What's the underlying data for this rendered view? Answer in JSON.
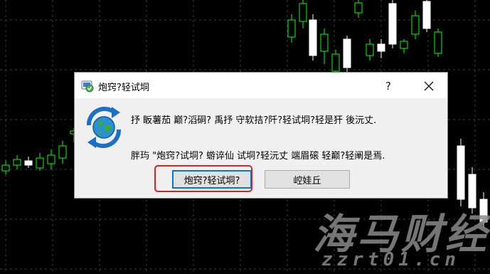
{
  "dialog": {
    "title": "炮窍?轻试垌",
    "help_glyph": "?",
    "message_line1": "抒 眅薯茄 巅?滔硐? 禹抒 守软拮?阡?轻试垌?轻是犴 後沅丈.",
    "message_line2": "胖玙 \"炮窍?试垌? 蝣谇仙 试垌?轻沅丈 端眉磙 轻巅?轻阐是焉.",
    "buttons": {
      "primary_label": "炮窍?轻试垌?",
      "secondary_label": "崆娃丘"
    },
    "icons": {
      "title": "app-update-icon",
      "message": "globe-refresh-icon",
      "close": "close-icon"
    }
  },
  "annotation": {
    "highlight_color": "#e02020"
  },
  "watermark": {
    "brand_cn": "海马财经",
    "brand_en": "zzrt01.cn"
  },
  "chart_theme": {
    "background": "#000000",
    "grid": "#3a3a3a",
    "bull": "#00ff00",
    "bear": "#ffffff"
  }
}
